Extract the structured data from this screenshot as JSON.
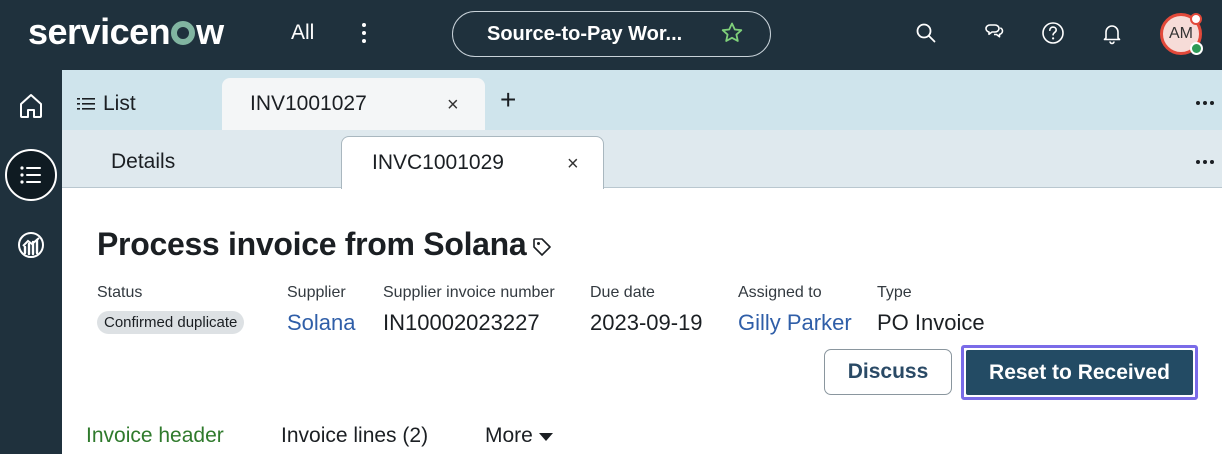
{
  "app": {
    "logo_text_1": "servicen",
    "logo_text_2": "w",
    "all_label": "All",
    "workspace_label": "Source-to-Pay Wor...",
    "avatar_initials": "AM",
    "icons": [
      "search-icon",
      "chat-icon",
      "help-icon",
      "bell-icon",
      "star-icon"
    ]
  },
  "rail": {
    "items": [
      "home-icon",
      "list-icon",
      "analytics-icon"
    ]
  },
  "tabs_primary": {
    "list_label": "List",
    "open_tab_label": "INV1001027",
    "close_symbol": "×",
    "add_symbol": "+"
  },
  "tabs_secondary": {
    "details_label": "Details",
    "open_tab_label": "INVC1001029",
    "close_symbol": "×"
  },
  "record": {
    "title": "Process invoice from Solana",
    "fields": [
      {
        "label": "Status",
        "value": "Confirmed duplicate"
      },
      {
        "label": "Supplier",
        "value": "Solana"
      },
      {
        "label": "Supplier invoice number",
        "value": "IN10002023227"
      },
      {
        "label": "Due date",
        "value": "2023-09-19"
      },
      {
        "label": "Assigned to",
        "value": "Gilly Parker"
      },
      {
        "label": "Type",
        "value": "PO Invoice"
      }
    ]
  },
  "actions": {
    "discuss_label": "Discuss",
    "reset_label": "Reset to Received"
  },
  "sub_tabs": {
    "header_label": "Invoice header",
    "lines_label": "Invoice lines (2)",
    "more_label": "More"
  },
  "colors": {
    "topbar": "#1f313d",
    "accent_green": "#81b5a1",
    "link_blue": "#2f5ea8",
    "primary_button": "#234b64",
    "focus_ring": "#7a6be8",
    "active_subtab": "#2f7a2c"
  }
}
